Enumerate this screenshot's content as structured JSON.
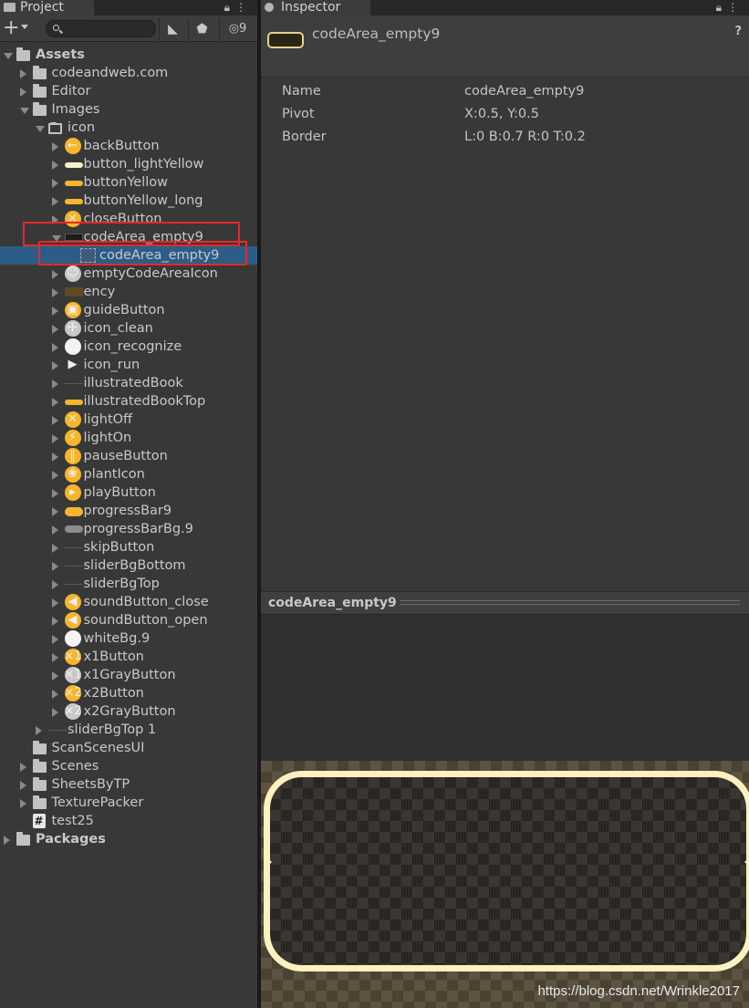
{
  "project": {
    "tab_label": "Project",
    "hidden_count": "9",
    "tree": [
      {
        "label": "Assets",
        "depth": 0,
        "expanded": true,
        "icon": "folder-icon",
        "bold": true
      },
      {
        "label": "codeandweb.com",
        "depth": 1,
        "expanded": false,
        "icon": "folder-icon"
      },
      {
        "label": "Editor",
        "depth": 1,
        "expanded": false,
        "icon": "folder-icon"
      },
      {
        "label": "Images",
        "depth": 1,
        "expanded": true,
        "icon": "folder-icon"
      },
      {
        "label": "icon",
        "depth": 2,
        "expanded": true,
        "icon": "folder-open-icon"
      },
      {
        "label": "backButton",
        "depth": 3,
        "expanded": false,
        "icon": "back-arrow-icon"
      },
      {
        "label": "button_lightYellow",
        "depth": 3,
        "expanded": false,
        "icon": "light-yellow-bar-icon"
      },
      {
        "label": "buttonYellow",
        "depth": 3,
        "expanded": false,
        "icon": "yellow-bar-icon"
      },
      {
        "label": "buttonYellow_long",
        "depth": 3,
        "expanded": false,
        "icon": "yellow-long-bar-icon"
      },
      {
        "label": "closeButton",
        "depth": 3,
        "expanded": false,
        "icon": "close-icon"
      },
      {
        "label": "codeArea_empty9",
        "depth": 3,
        "expanded": true,
        "icon": "dark-panel-icon"
      },
      {
        "label": "codeArea_empty9",
        "depth": 4,
        "expanded": null,
        "icon": "sprite-icon",
        "selected": true
      },
      {
        "label": "emptyCodeAreaIcon",
        "depth": 3,
        "expanded": false,
        "icon": "robot-icon"
      },
      {
        "label": "ency",
        "depth": 3,
        "expanded": false,
        "icon": "brown-panel-icon"
      },
      {
        "label": "guideButton",
        "depth": 3,
        "expanded": false,
        "icon": "guide-icon"
      },
      {
        "label": "icon_clean",
        "depth": 3,
        "expanded": false,
        "icon": "broom-icon"
      },
      {
        "label": "icon_recognize",
        "depth": 3,
        "expanded": false,
        "icon": "magnifier-icon"
      },
      {
        "label": "icon_run",
        "depth": 3,
        "expanded": false,
        "icon": "play-triangle-icon"
      },
      {
        "label": "illustratedBook",
        "depth": 3,
        "expanded": false,
        "icon": "book-icon"
      },
      {
        "label": "illustratedBookTop",
        "depth": 3,
        "expanded": false,
        "icon": "book-top-icon"
      },
      {
        "label": "lightOff",
        "depth": 3,
        "expanded": false,
        "icon": "light-off-icon"
      },
      {
        "label": "lightOn",
        "depth": 3,
        "expanded": false,
        "icon": "light-on-icon"
      },
      {
        "label": "pauseButton",
        "depth": 3,
        "expanded": false,
        "icon": "pause-icon"
      },
      {
        "label": "plantIcon",
        "depth": 3,
        "expanded": false,
        "icon": "plant-icon"
      },
      {
        "label": "playButton",
        "depth": 3,
        "expanded": false,
        "icon": "play-icon"
      },
      {
        "label": "progressBar9",
        "depth": 3,
        "expanded": false,
        "icon": "progress-bar-icon"
      },
      {
        "label": "progressBarBg.9",
        "depth": 3,
        "expanded": false,
        "icon": "progress-bar-bg-icon"
      },
      {
        "label": "skipButton",
        "depth": 3,
        "expanded": false,
        "icon": "skip-icon"
      },
      {
        "label": "sliderBgBottom",
        "depth": 3,
        "expanded": false,
        "icon": "slider-line-icon"
      },
      {
        "label": "sliderBgTop",
        "depth": 3,
        "expanded": false,
        "icon": "slider-line-icon"
      },
      {
        "label": "soundButton_close",
        "depth": 3,
        "expanded": false,
        "icon": "sound-close-icon"
      },
      {
        "label": "soundButton_open",
        "depth": 3,
        "expanded": false,
        "icon": "sound-open-icon"
      },
      {
        "label": "whiteBg.9",
        "depth": 3,
        "expanded": false,
        "icon": "white-circle-icon"
      },
      {
        "label": "x1Button",
        "depth": 3,
        "expanded": false,
        "icon": "x1-icon"
      },
      {
        "label": "x1GrayButton",
        "depth": 3,
        "expanded": false,
        "icon": "x1-gray-icon"
      },
      {
        "label": "x2Button",
        "depth": 3,
        "expanded": false,
        "icon": "x2-icon"
      },
      {
        "label": "x2GrayButton",
        "depth": 3,
        "expanded": false,
        "icon": "x2-gray-icon"
      },
      {
        "label": "sliderBgTop 1",
        "depth": 2,
        "expanded": false,
        "icon": "slider-line-icon"
      },
      {
        "label": "ScanScenesUI",
        "depth": 1,
        "expanded": null,
        "icon": "folder-icon"
      },
      {
        "label": "Scenes",
        "depth": 1,
        "expanded": false,
        "icon": "folder-icon"
      },
      {
        "label": "SheetsByTP",
        "depth": 1,
        "expanded": false,
        "icon": "folder-icon"
      },
      {
        "label": "TexturePacker",
        "depth": 1,
        "expanded": false,
        "icon": "folder-icon"
      },
      {
        "label": "test25",
        "depth": 1,
        "expanded": null,
        "icon": "script-hash-icon"
      },
      {
        "label": "Packages",
        "depth": 0,
        "expanded": false,
        "icon": "folder-icon",
        "bold": true
      }
    ]
  },
  "inspector": {
    "tab_label": "Inspector",
    "title": "codeArea_empty9",
    "help_glyph": "?",
    "properties": [
      {
        "name": "Name",
        "value": "codeArea_empty9"
      },
      {
        "name": "Pivot",
        "value": "X:0.5, Y:0.5"
      },
      {
        "name": "Border",
        "value": "L:0 B:0.7 R:0 T:0.2"
      }
    ],
    "preview_title": "codeArea_empty9"
  },
  "watermark": "https://blog.csdn.net/Wrinkle2017",
  "colors": {
    "selection": "#2c5d87",
    "highlight_box": "#e62929",
    "icon_yellow": "#f7b52c",
    "frame_border": "#fff0c0"
  }
}
